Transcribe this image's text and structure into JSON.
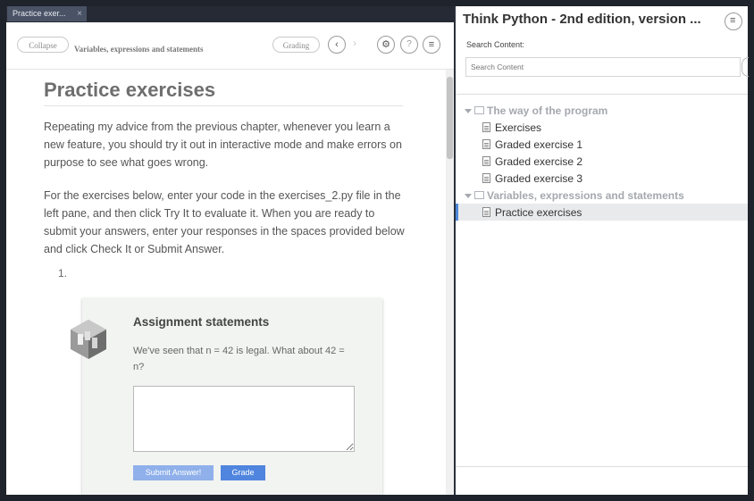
{
  "tab": {
    "label": "Practice exer...",
    "close": "×"
  },
  "toolbar": {
    "collapse_label": "Collapse",
    "breadcrumb": "Variables, expressions and statements",
    "grading_label": "Grading",
    "help_label": "?"
  },
  "page": {
    "title": "Practice exercises",
    "para1": "Repeating my advice from the previous chapter, whenever you learn a new feature, you should try it out in interactive mode and make errors on purpose to see what goes wrong.",
    "para2": "For the exercises below, enter your code in the exercises_2.py file in the left pane, and then click Try It to evaluate it. When you are ready to submit your answers, enter your responses in the spaces provided below and click Check It or Submit Answer.",
    "list_number": "1."
  },
  "assignment": {
    "title": "Assignment statements",
    "text": "We've seen that n = 42 is legal. What about 42 = n?",
    "answer": "",
    "submit_label": "Submit Answer!",
    "grade_label": "Grade"
  },
  "sidebar": {
    "title": "Think Python - 2nd edition, version ...",
    "search_label": "Search Content:",
    "search_placeholder": "Search Content",
    "chapters": [
      {
        "label": "The way of the program",
        "items": [
          "Exercises",
          "Graded exercise 1",
          "Graded exercise 2",
          "Graded exercise 3"
        ]
      },
      {
        "label": "Variables, expressions and statements",
        "items": [
          "Practice exercises"
        ]
      }
    ]
  },
  "colors": {
    "accent": "#4d86d8",
    "submit_bg": "#8fb0ea",
    "grade_bg": "#4f85de"
  }
}
